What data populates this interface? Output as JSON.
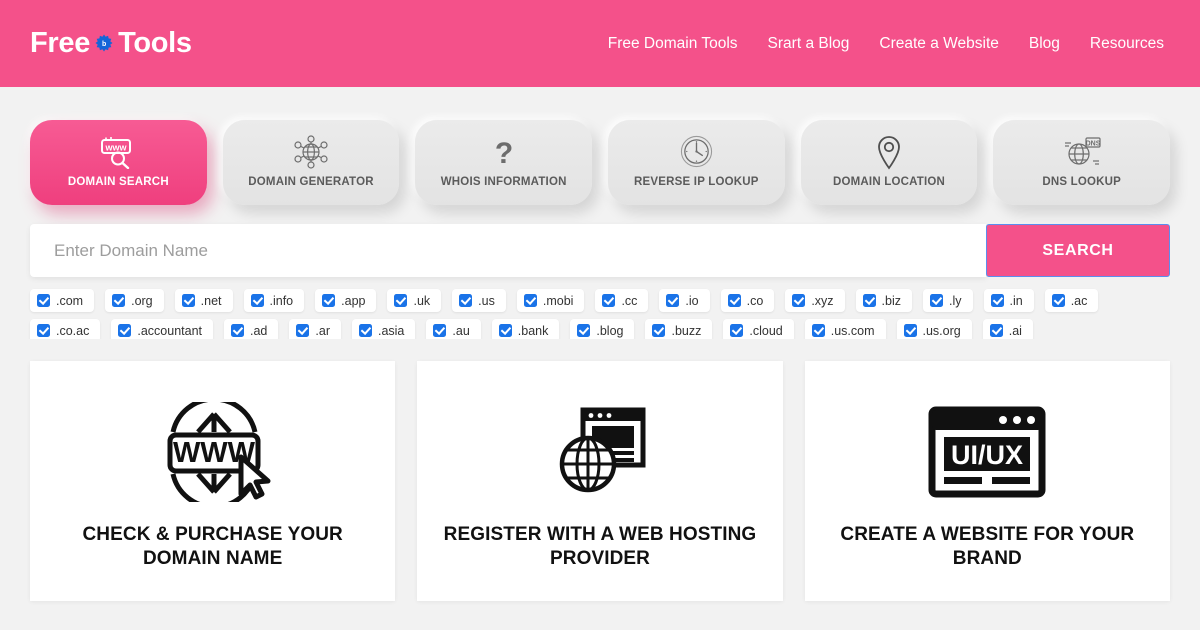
{
  "header": {
    "logo": {
      "text_before": "Free",
      "text_after": "Tools",
      "gear_icon": "gear-icon",
      "gear_letter": "b"
    },
    "nav": [
      {
        "label": "Free Domain Tools"
      },
      {
        "label": "Srart a Blog"
      },
      {
        "label": "Create a Website"
      },
      {
        "label": "Blog"
      },
      {
        "label": "Resources"
      }
    ],
    "brand_color": "#f4518a"
  },
  "tabs": [
    {
      "label": "DOMAIN SEARCH",
      "icon": "www-search-icon",
      "active": true
    },
    {
      "label": "DOMAIN GENERATOR",
      "icon": "network-globe-icon",
      "active": false
    },
    {
      "label": "WHOIS INFORMATION",
      "icon": "question-mark-icon",
      "active": false
    },
    {
      "label": "REVERSE IP LOOKUP",
      "icon": "clock-icon",
      "active": false
    },
    {
      "label": "DOMAIN LOCATION",
      "icon": "map-pin-icon",
      "active": false
    },
    {
      "label": "DNS LOOKUP",
      "icon": "dns-globe-icon",
      "active": false
    }
  ],
  "search": {
    "placeholder": "Enter Domain Name",
    "value": "",
    "button_label": "SEARCH",
    "button_color": "#f4518a"
  },
  "tlds": {
    "checkbox_color": "#1a73e8",
    "items": [
      {
        "label": ".com",
        "checked": true
      },
      {
        "label": ".org",
        "checked": true
      },
      {
        "label": ".net",
        "checked": true
      },
      {
        "label": ".info",
        "checked": true
      },
      {
        "label": ".app",
        "checked": true
      },
      {
        "label": ".uk",
        "checked": true
      },
      {
        "label": ".us",
        "checked": true
      },
      {
        "label": ".mobi",
        "checked": true
      },
      {
        "label": ".cc",
        "checked": true
      },
      {
        "label": ".io",
        "checked": true
      },
      {
        "label": ".co",
        "checked": true
      },
      {
        "label": ".xyz",
        "checked": true
      },
      {
        "label": ".biz",
        "checked": true
      },
      {
        "label": ".ly",
        "checked": true
      },
      {
        "label": ".in",
        "checked": true
      },
      {
        "label": ".ac",
        "checked": true
      },
      {
        "label": ".co.ac",
        "checked": true
      },
      {
        "label": ".accountant",
        "checked": true
      },
      {
        "label": ".ad",
        "checked": true
      },
      {
        "label": ".ar",
        "checked": true
      },
      {
        "label": ".asia",
        "checked": true
      },
      {
        "label": ".au",
        "checked": true
      },
      {
        "label": ".bank",
        "checked": true
      },
      {
        "label": ".blog",
        "checked": true
      },
      {
        "label": ".buzz",
        "checked": true
      },
      {
        "label": ".cloud",
        "checked": true
      },
      {
        "label": ".us.com",
        "checked": true
      },
      {
        "label": ".us.org",
        "checked": true
      },
      {
        "label": ".ai",
        "checked": true
      }
    ]
  },
  "cards": [
    {
      "title": "CHECK & PURCHASE YOUR DOMAIN NAME",
      "icon": "www-globe-cursor-icon"
    },
    {
      "title": "REGISTER WITH A WEB HOSTING PROVIDER",
      "icon": "globe-browser-icon"
    },
    {
      "title": "CREATE A WEBSITE FOR YOUR BRAND",
      "icon": "uiux-browser-icon"
    }
  ]
}
